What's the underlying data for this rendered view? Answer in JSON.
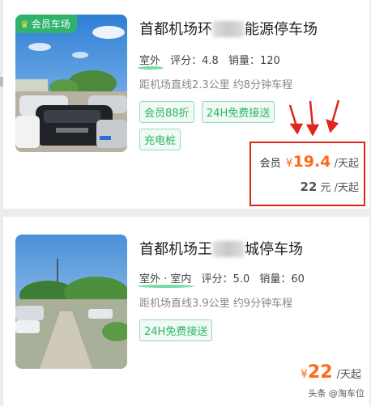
{
  "listings": [
    {
      "badge": "会员车场",
      "title_prefix": "首都机场环",
      "title_suffix": "能源停车场",
      "location": "室外",
      "rating": "评分：4.8",
      "sales": "销量：120",
      "distance": "距机场直线2.3公里 约8分钟车程",
      "tags": [
        "会员88折",
        "24H免费接送",
        "充电桩"
      ],
      "member_label": "会员",
      "currency": "¥",
      "member_price": "19.4",
      "unit": "/天起",
      "regular_price": "22",
      "regular_currency": "元"
    },
    {
      "title_prefix": "首都机场王",
      "title_suffix": "城停车场",
      "location": "室外 · 室内",
      "rating": "评分：5.0",
      "sales": "销量：60",
      "distance": "距机场直线3.9公里 约9分钟车程",
      "tags": [
        "24H免费接送"
      ],
      "currency": "¥",
      "price": "22",
      "unit": "/天起"
    }
  ],
  "watermark": "头条 @淘车位",
  "colors": {
    "accent_green": "#2fb36b",
    "price_orange": "#ff6a1a",
    "annotation_red": "#e0251b"
  }
}
